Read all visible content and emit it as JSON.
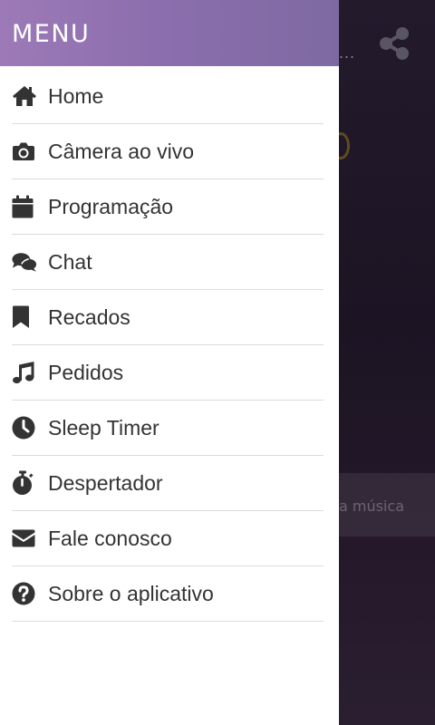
{
  "background": {
    "overflow_dots": "...",
    "now_playing_text": "a música",
    "share_icon": "share-icon"
  },
  "drawer": {
    "title": "MENU",
    "items": [
      {
        "label": "Home",
        "icon": "home-icon"
      },
      {
        "label": "Câmera ao vivo",
        "icon": "camera-icon"
      },
      {
        "label": "Programação",
        "icon": "calendar-icon"
      },
      {
        "label": "Chat",
        "icon": "chat-icon"
      },
      {
        "label": "Recados",
        "icon": "bookmark-icon"
      },
      {
        "label": "Pedidos",
        "icon": "music-note-icon"
      },
      {
        "label": "Sleep Timer",
        "icon": "clock-icon"
      },
      {
        "label": "Despertador",
        "icon": "stopwatch-icon"
      },
      {
        "label": "Fale conosco",
        "icon": "envelope-icon"
      },
      {
        "label": "Sobre o aplicativo",
        "icon": "help-icon"
      }
    ]
  },
  "colors": {
    "header_start": "#9d7ab7",
    "header_end": "#7e6aa2",
    "text": "#333333",
    "divider": "#dcdcdc",
    "background": "#1c1423"
  }
}
